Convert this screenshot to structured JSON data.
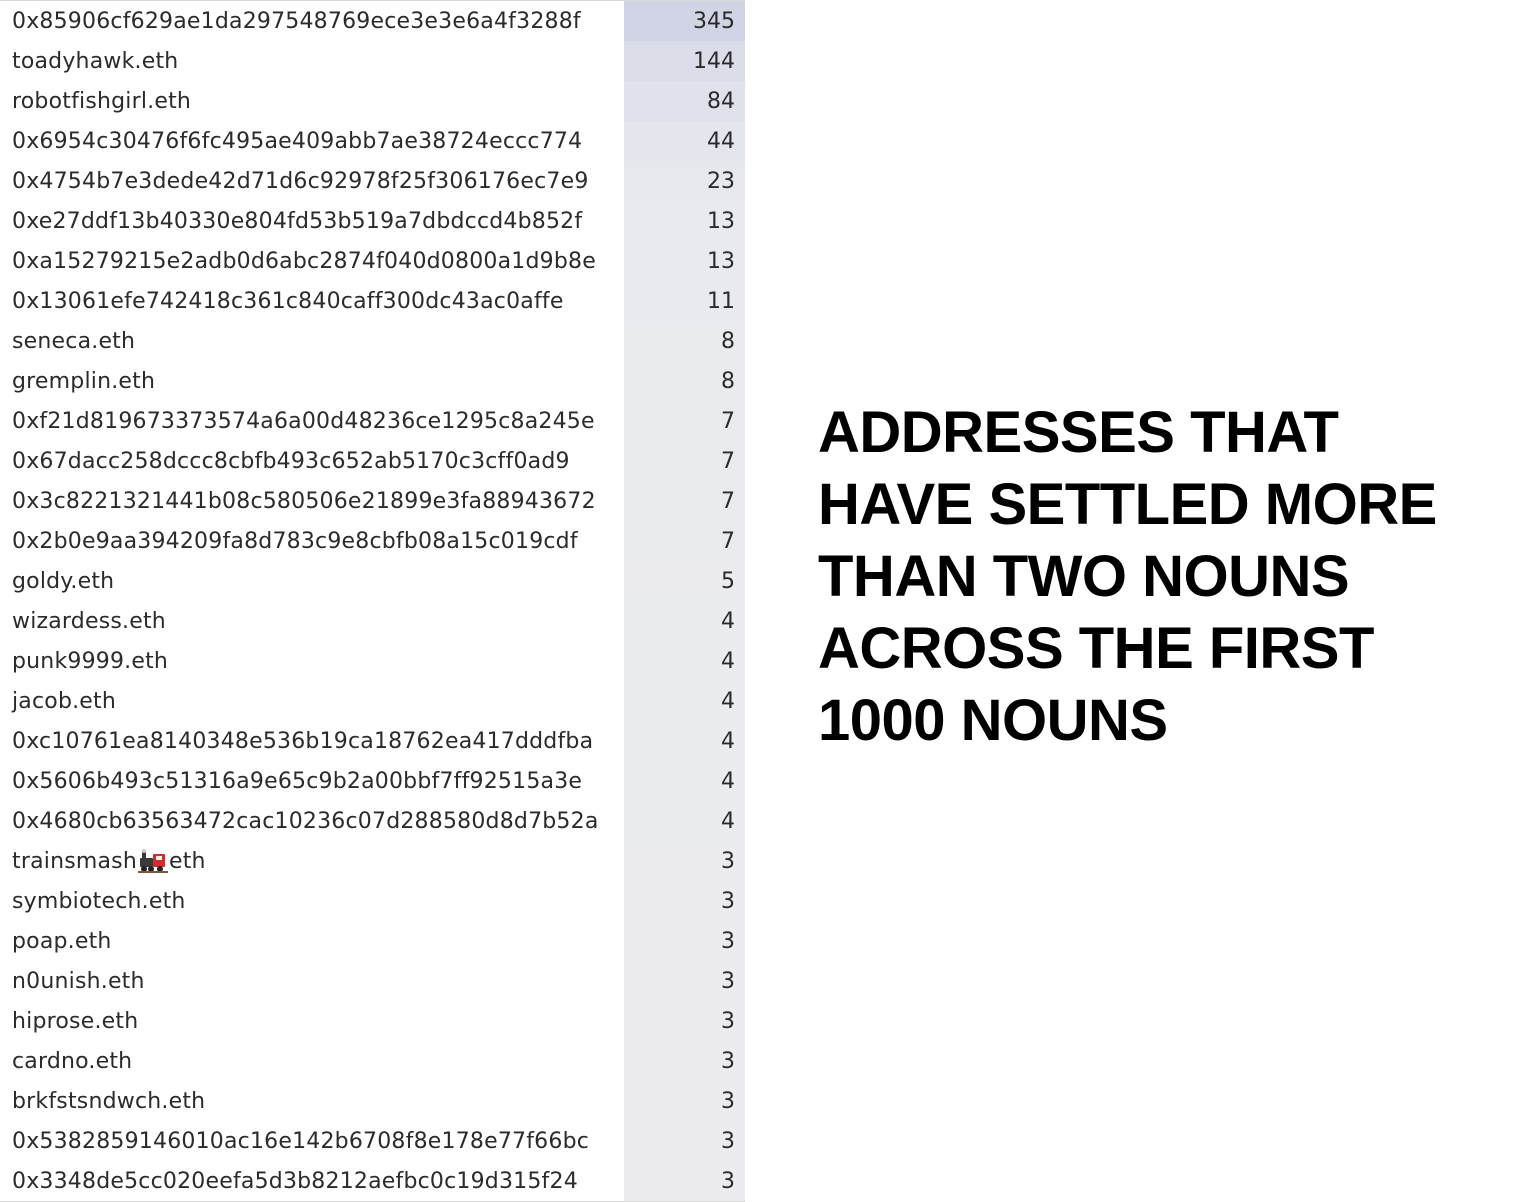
{
  "headline": "ADDRESSES THAT HAVE SETTLED MORE THAN TWO NOUNS ACROSS THE FIRST 1000 NOUNS",
  "colors": {
    "row_shade_base": "#eeeef1",
    "row_shade_max": "#d0d4e4"
  },
  "rows": [
    {
      "address": "0x85906cf629ae1da297548769ece3e3e6a4f3288f",
      "count": 345
    },
    {
      "address": "toadyhawk.eth",
      "count": 144
    },
    {
      "address": "robotfishgirl.eth",
      "count": 84
    },
    {
      "address": "0x6954c30476f6fc495ae409abb7ae38724eccc774",
      "count": 44
    },
    {
      "address": "0x4754b7e3dede42d71d6c92978f25f306176ec7e9",
      "count": 23
    },
    {
      "address": "0xe27ddf13b40330e804fd53b519a7dbdccd4b852f",
      "count": 13
    },
    {
      "address": "0xa15279215e2adb0d6abc2874f040d0800a1d9b8e",
      "count": 13
    },
    {
      "address": "0x13061efe742418c361c840caff300dc43ac0affe",
      "count": 11
    },
    {
      "address": "seneca.eth",
      "count": 8
    },
    {
      "address": "gremplin.eth",
      "count": 8
    },
    {
      "address": "0xf21d819673373574a6a00d48236ce1295c8a245e",
      "count": 7
    },
    {
      "address": "0x67dacc258dccc8cbfb493c652ab5170c3cff0ad9",
      "count": 7
    },
    {
      "address": "0x3c8221321441b08c580506e21899e3fa88943672",
      "count": 7
    },
    {
      "address": "0x2b0e9aa394209fa8d783c9e8cbfb08a15c019cdf",
      "count": 7
    },
    {
      "address": "goldy.eth",
      "count": 5
    },
    {
      "address": "wizardess.eth",
      "count": 4
    },
    {
      "address": "punk9999.eth",
      "count": 4
    },
    {
      "address": "jacob.eth",
      "count": 4
    },
    {
      "address": "0xc10761ea8140348e536b19ca18762ea417dddfba",
      "count": 4
    },
    {
      "address": "0x5606b493c51316a9e65c9b2a00bbf7ff92515a3e",
      "count": 4
    },
    {
      "address": "0x4680cb63563472cac10236c07d288580d8d7b52a",
      "count": 4
    },
    {
      "address": "trainsmash",
      "address_suffix": "eth",
      "icon": "train-icon",
      "count": 3
    },
    {
      "address": "symbiotech.eth",
      "count": 3
    },
    {
      "address": "poap.eth",
      "count": 3
    },
    {
      "address": "n0unish.eth",
      "count": 3
    },
    {
      "address": "hiprose.eth",
      "count": 3
    },
    {
      "address": "cardno.eth",
      "count": 3
    },
    {
      "address": "brkfstsndwch.eth",
      "count": 3
    },
    {
      "address": "0x5382859146010ac16e142b6708f8e178e77f66bc",
      "count": 3
    },
    {
      "address": "0x3348de5cc020eefa5d3b8212aefbc0c19d315f24",
      "count": 3
    }
  ]
}
